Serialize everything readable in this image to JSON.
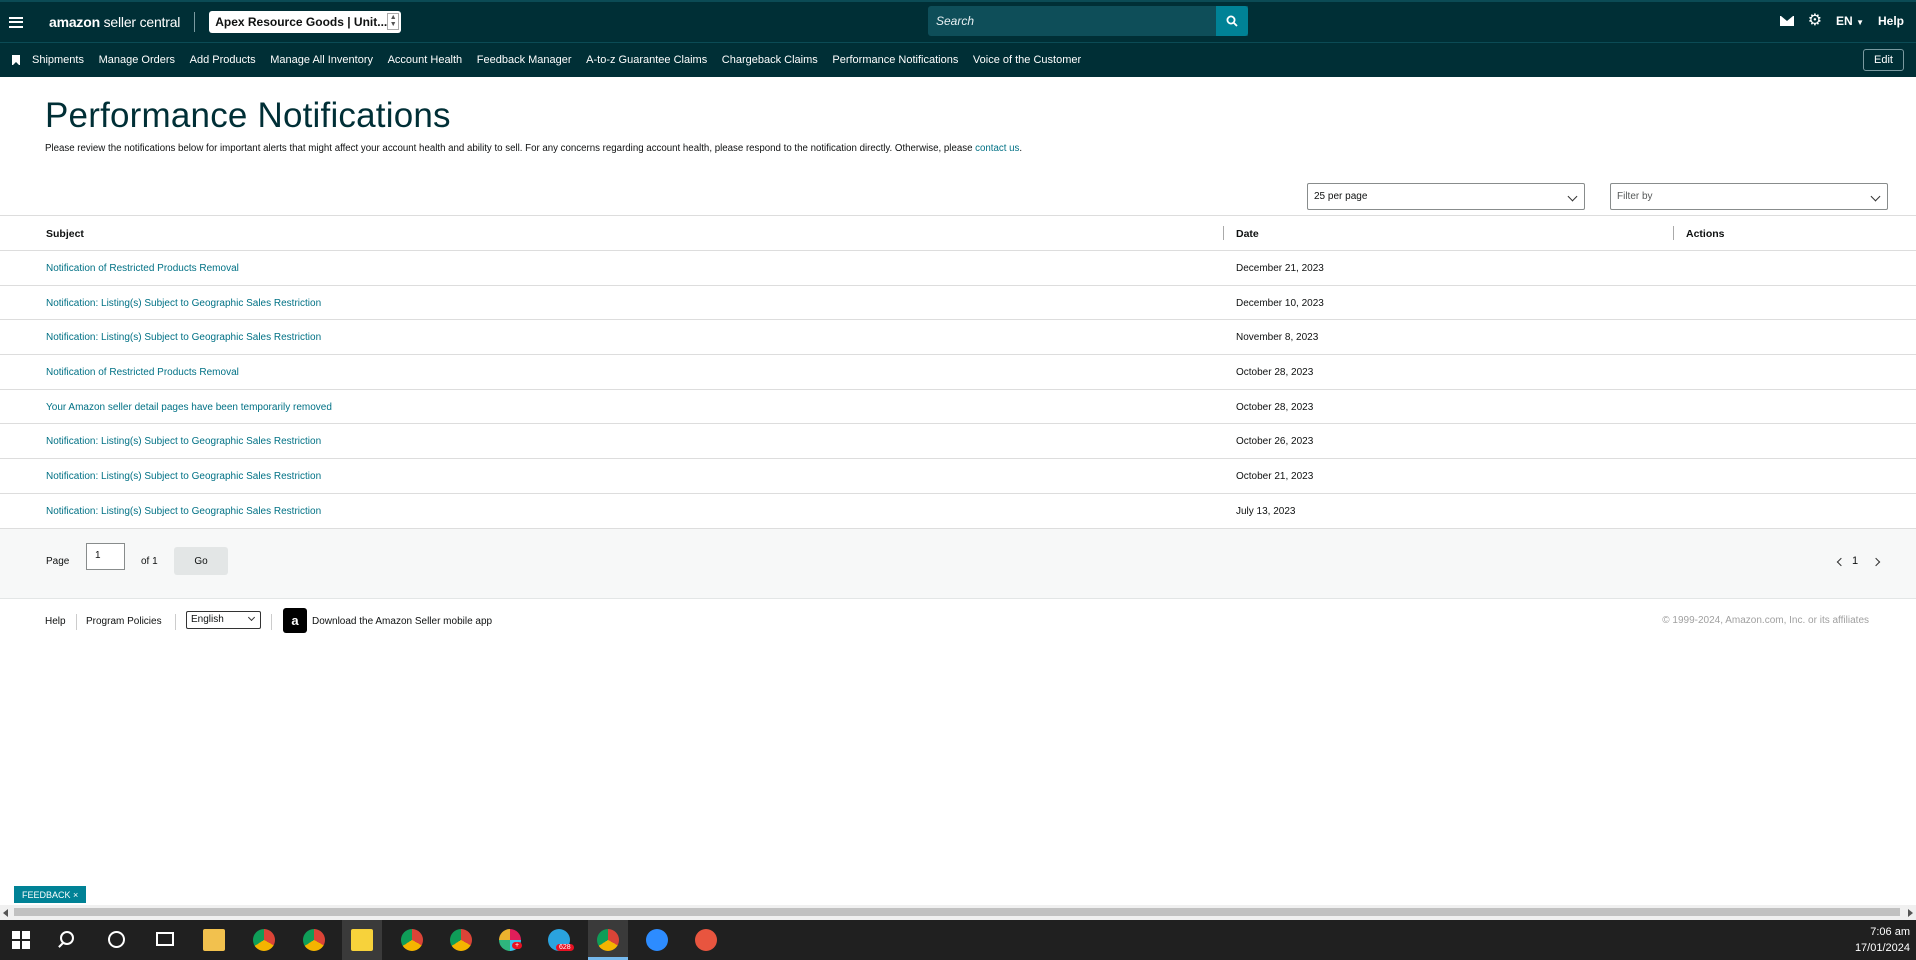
{
  "topbar": {
    "logo_bold": "amazon",
    "logo_rest": " seller central",
    "store_name": "Apex Resource Goods | Unit...",
    "search_placeholder": "Search",
    "language": "EN",
    "help": "Help"
  },
  "nav": {
    "items": [
      "Shipments",
      "Manage Orders",
      "Add Products",
      "Manage All Inventory",
      "Account Health",
      "Feedback Manager",
      "A-to-z Guarantee Claims",
      "Chargeback Claims",
      "Performance Notifications",
      "Voice of the Customer"
    ],
    "edit": "Edit"
  },
  "page": {
    "title": "Performance Notifications",
    "intro": "Please review the notifications below for important alerts that might affect your account health and ability to sell. For any concerns regarding account health, please respond to the notification directly. Otherwise, please ",
    "intro_link": "contact us",
    "intro_end": ".",
    "per_page": "25 per page",
    "filter_placeholder": "Filter by"
  },
  "table": {
    "headers": {
      "subject": "Subject",
      "date": "Date",
      "actions": "Actions"
    },
    "rows": [
      {
        "subject": "Notification of Restricted Products Removal",
        "date": "December 21, 2023"
      },
      {
        "subject": "Notification: Listing(s) Subject to Geographic Sales Restriction",
        "date": "December 10, 2023"
      },
      {
        "subject": "Notification: Listing(s) Subject to Geographic Sales Restriction",
        "date": "November 8, 2023"
      },
      {
        "subject": "Notification of Restricted Products Removal",
        "date": "October 28, 2023"
      },
      {
        "subject": "Your Amazon seller detail pages have been temporarily removed",
        "date": "October 28, 2023"
      },
      {
        "subject": "Notification: Listing(s) Subject to Geographic Sales Restriction",
        "date": "October 26, 2023"
      },
      {
        "subject": "Notification: Listing(s) Subject to Geographic Sales Restriction",
        "date": "October 21, 2023"
      },
      {
        "subject": "Notification: Listing(s) Subject to Geographic Sales Restriction",
        "date": "July 13, 2023"
      }
    ]
  },
  "pager": {
    "page_label": "Page",
    "page_value": "1",
    "of_label": "of 1",
    "go": "Go",
    "current": "1"
  },
  "footer": {
    "help": "Help",
    "policies": "Program Policies",
    "language": "English",
    "app": "Download the Amazon Seller mobile app",
    "copyright": "© 1999-2024, Amazon.com, Inc. or its affiliates"
  },
  "feedback": "FEEDBACK ×",
  "taskbar": {
    "time": "7:06 am",
    "date": "17/01/2024",
    "badges": {
      "slack": "+",
      "telegram": "628"
    }
  },
  "colors": {
    "header_bg": "#002f36",
    "link": "#007185",
    "accent": "#008296"
  }
}
